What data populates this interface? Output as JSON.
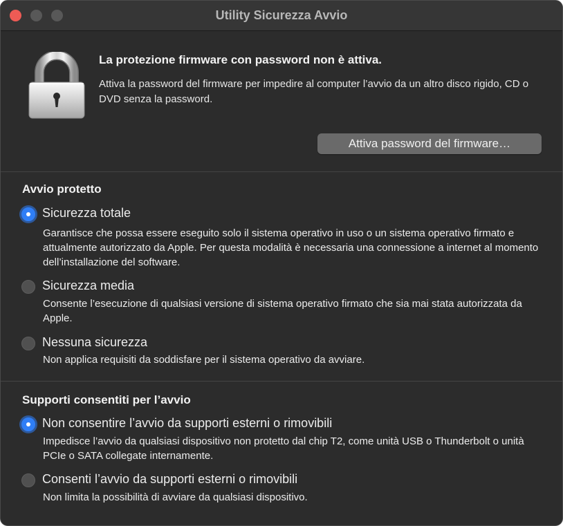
{
  "window": {
    "title": "Utility Sicurezza Avvio"
  },
  "firmware": {
    "heading": "La protezione firmware con password non è attiva.",
    "description": "Attiva la password del firmware per impedire al computer l’avvio da un altro disco rigido, CD o DVD senza la password.",
    "button_label": "Attiva password del firmware…"
  },
  "secure_boot": {
    "heading": "Avvio protetto",
    "options": [
      {
        "label": "Sicurezza totale",
        "selected": true,
        "description": "Garantisce che possa essere eseguito solo il sistema operativo in uso o un sistema operativo firmato e attualmente autorizzato da Apple. Per questa modalità è necessaria una connessione a internet al momento dell’installazione del software."
      },
      {
        "label": "Sicurezza media",
        "selected": false,
        "description": "Consente l’esecuzione di qualsiasi versione di sistema operativo firmato che sia mai stata autorizzata da Apple."
      },
      {
        "label": "Nessuna sicurezza",
        "selected": false,
        "description": "Non applica requisiti da soddisfare per il sistema operativo da avviare."
      }
    ]
  },
  "boot_media": {
    "heading": "Supporti consentiti per l’avvio",
    "options": [
      {
        "label": "Non consentire l’avvio da supporti esterni o rimovibili",
        "selected": true,
        "description": "Impedisce l’avvio da qualsiasi dispositivo non protetto dal chip T2, come unità USB o Thunderbolt o unità PCIe o SATA collegate internamente."
      },
      {
        "label": "Consenti l’avvio da supporti esterni o rimovibili",
        "selected": false,
        "description": "Non limita la possibilità di avviare da qualsiasi dispositivo."
      }
    ]
  },
  "icons": {
    "lock": "lock-icon",
    "close": "close-button",
    "minimize": "minimize-button",
    "zoom": "zoom-button"
  },
  "colors": {
    "window_bg": "#2c2c2c",
    "accent": "#2f7ef6",
    "close_red": "#ee5b55"
  }
}
